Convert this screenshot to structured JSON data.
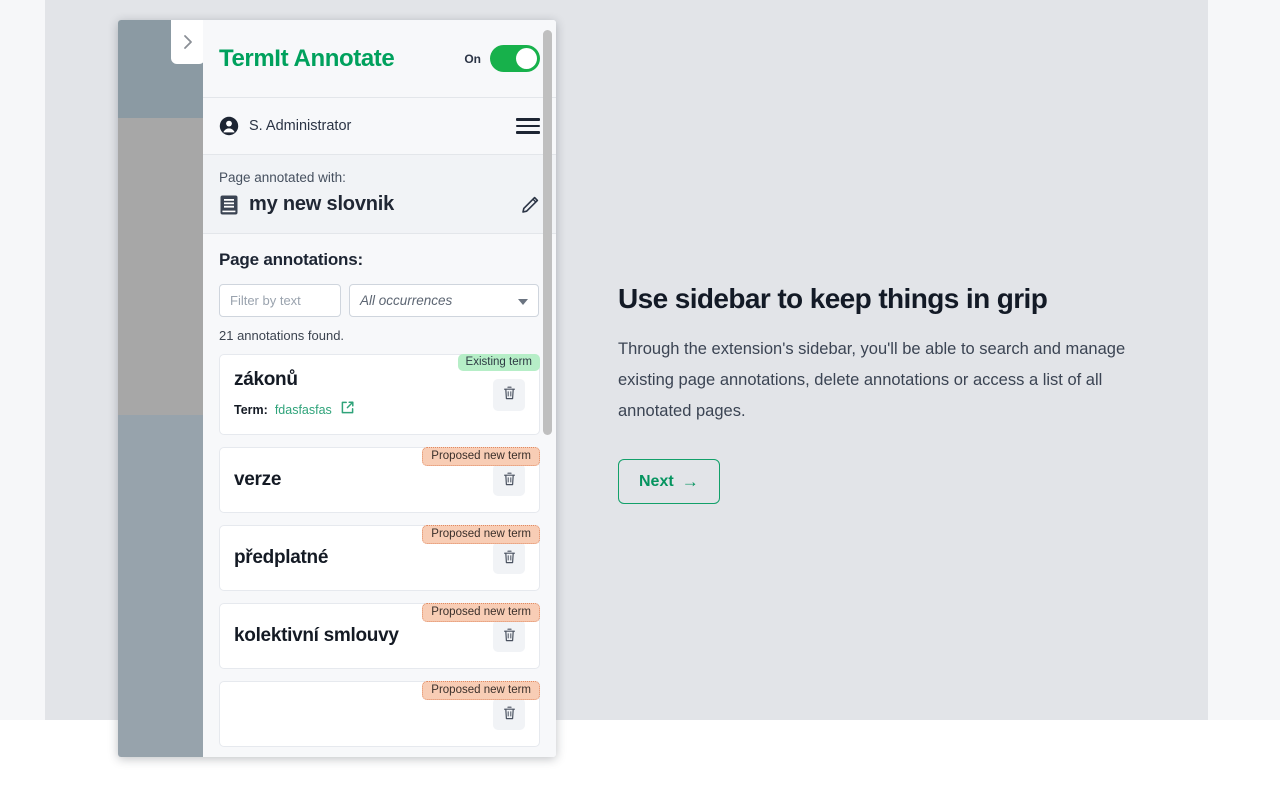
{
  "background": {
    "main_color": "#e2e4e8",
    "edge_color": "#f6f7f9",
    "bottom_color": "#ffffff"
  },
  "overlay": {
    "collapse_tab_icon": "chevron-right-icon",
    "band_colors": [
      "#8b9aa3",
      "#a7a7a7",
      "#97a3ac"
    ]
  },
  "sidebar": {
    "brand": "TermIt Annotate",
    "brand_color": "#00a15d",
    "toggle": {
      "label": "On",
      "state_on": true,
      "on_color": "#17b14b"
    },
    "user": {
      "name": "S. Administrator",
      "avatar_icon": "user-circle-icon",
      "menu_icon": "hamburger-menu-icon"
    },
    "vocabulary": {
      "label": "Page annotated with:",
      "name": "my new slovnik",
      "book_icon": "book-icon",
      "edit_icon": "pencil-icon"
    },
    "annotations": {
      "title": "Page annotations:",
      "filter_placeholder": "Filter by text",
      "filter_value": "",
      "occurrence_select": "All occurrences",
      "select_caret_icon": "chevron-down-icon",
      "found_text": "21 annotations found.",
      "items": [
        {
          "term": "zákonů",
          "badge": "Existing term",
          "badge_type": "existing",
          "meta_key": "Term:",
          "meta_value": "fdasfasfas",
          "has_link": true,
          "delete_icon": "trash-icon"
        },
        {
          "term": "verze",
          "badge": "Proposed new term",
          "badge_type": "proposed",
          "has_link": false,
          "delete_icon": "trash-icon"
        },
        {
          "term": "předplatné",
          "badge": "Proposed new term",
          "badge_type": "proposed",
          "has_link": false,
          "delete_icon": "trash-icon"
        },
        {
          "term": "kolektivní smlouvy",
          "badge": "Proposed new term",
          "badge_type": "proposed",
          "has_link": false,
          "delete_icon": "trash-icon"
        },
        {
          "term": "",
          "badge": "Proposed new term",
          "badge_type": "proposed",
          "has_link": false,
          "delete_icon": "trash-icon"
        }
      ]
    }
  },
  "tooltip": {
    "title": "Use sidebar to keep things in grip",
    "body": "Through the extension's sidebar, you'll be able to search and manage existing page annotations, delete annotations or access a list of all annotated pages.",
    "next_label": "Next",
    "next_arrow": "→",
    "accent_color": "#05945f"
  }
}
